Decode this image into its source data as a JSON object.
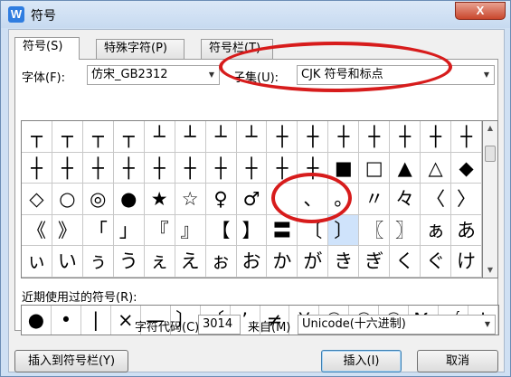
{
  "window": {
    "title": "符号",
    "icon": "W",
    "close": "X"
  },
  "tabs": [
    {
      "label": "符号(S)",
      "active": true
    },
    {
      "label": "特殊字符(P)",
      "active": false
    },
    {
      "label": "符号栏(T)",
      "active": false
    }
  ],
  "font": {
    "label": "字体(F):",
    "value": "仿宋_GB2312"
  },
  "subset": {
    "label": "子集(U):",
    "value": "CJK 符号和标点"
  },
  "symbol_grid": {
    "rows": [
      [
        "┬",
        "┬",
        "┬",
        "┬",
        "┴",
        "┴",
        "┴",
        "┴",
        "┼",
        "┼",
        "┼",
        "┼",
        "┼",
        "┼",
        "┼"
      ],
      [
        "┼",
        "┼",
        "┼",
        "┼",
        "┼",
        "┼",
        "┼",
        "┼",
        "┼",
        "┼",
        "■",
        "□",
        "▲",
        "△",
        "◆"
      ],
      [
        "◇",
        "○",
        "◎",
        "●",
        "★",
        "☆",
        "♀",
        "♂",
        "",
        "、",
        "。",
        "〃",
        "々",
        "〈",
        "〉"
      ],
      [
        "《",
        "》",
        "「",
        "」",
        "『",
        "』",
        "【",
        "】",
        "〓",
        "〔",
        "〕",
        "〖",
        "〗",
        "ぁ",
        "あ"
      ],
      [
        "ぃ",
        "い",
        "ぅ",
        "う",
        "ぇ",
        "え",
        "ぉ",
        "お",
        "か",
        "が",
        "き",
        "ぎ",
        "く",
        "ぐ",
        "け"
      ]
    ],
    "selected": "〕"
  },
  "recent": {
    "label": "近期使用过的符号(R):",
    "symbols": [
      "●",
      "•",
      "|",
      "×",
      "—",
      "〕",
      "〔",
      "’",
      "≠",
      "¥",
      "①",
      "②",
      "③",
      "№",
      "√",
      "↓"
    ]
  },
  "charcode": {
    "label": "字符代码(C):",
    "value": "3014",
    "from_label": "来自(M)",
    "from_value": "Unicode(十六进制)"
  },
  "buttons": {
    "insert_to_bar": "插入到符号栏(Y)",
    "insert": "插入(I)",
    "cancel": "取消"
  },
  "colors": {
    "annotation": "#d71c1c",
    "selected_cell": "#cfe3fb"
  }
}
